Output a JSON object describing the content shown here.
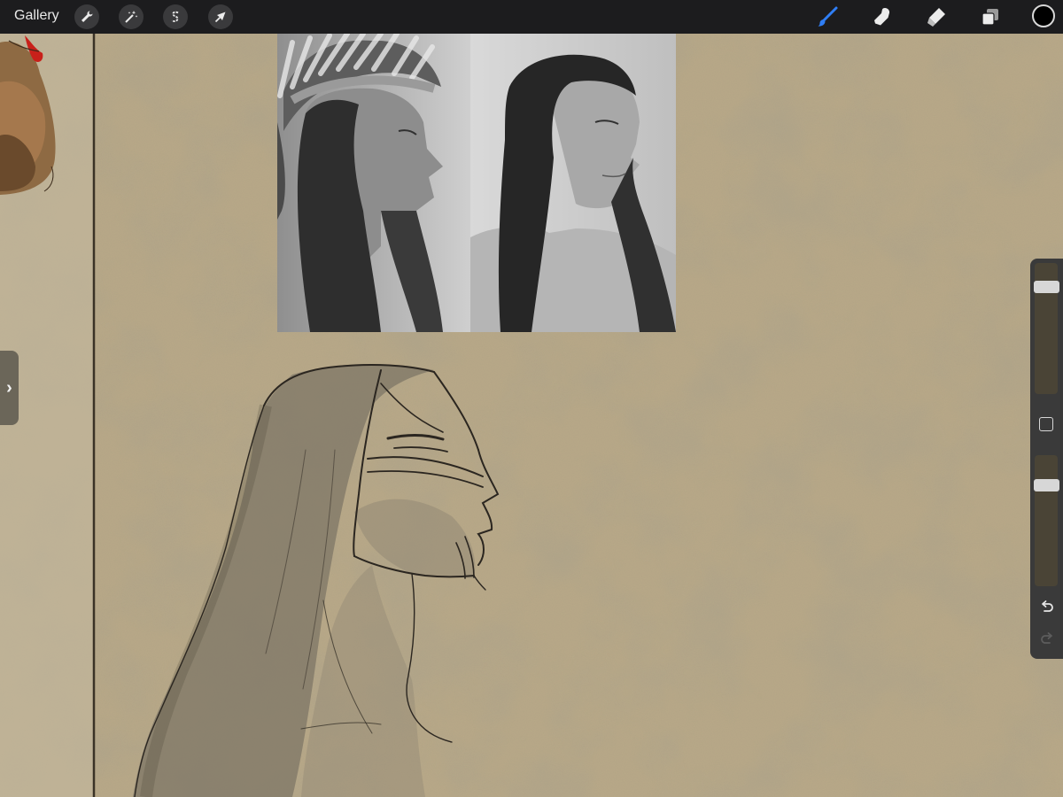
{
  "app": {
    "gallery_label": "Gallery"
  },
  "toolbar_left": [
    {
      "name": "actions",
      "icon": "wrench-icon"
    },
    {
      "name": "adjustments",
      "icon": "magic-wand-icon"
    },
    {
      "name": "selection",
      "icon": "selection-s-icon"
    },
    {
      "name": "transform",
      "icon": "arrow-cursor-icon"
    }
  ],
  "toolbar_right": [
    {
      "name": "brush",
      "icon": "brush-icon",
      "active": true
    },
    {
      "name": "smudge",
      "icon": "smudge-finger-icon",
      "active": false
    },
    {
      "name": "eraser",
      "icon": "eraser-icon",
      "active": false
    },
    {
      "name": "layers",
      "icon": "layers-icon",
      "active": false
    }
  ],
  "current_color": "#000000",
  "accent_color": "#2f7ef5",
  "sidebar": {
    "brush_size_level": 0.85,
    "brush_opacity_level": 0.8,
    "undo_enabled": true,
    "redo_enabled": false
  },
  "canvas": {
    "background_color": "#b7a785",
    "reference_photos": [
      {
        "name": "portrait-with-headdress"
      },
      {
        "name": "portrait-long-hair"
      }
    ]
  }
}
